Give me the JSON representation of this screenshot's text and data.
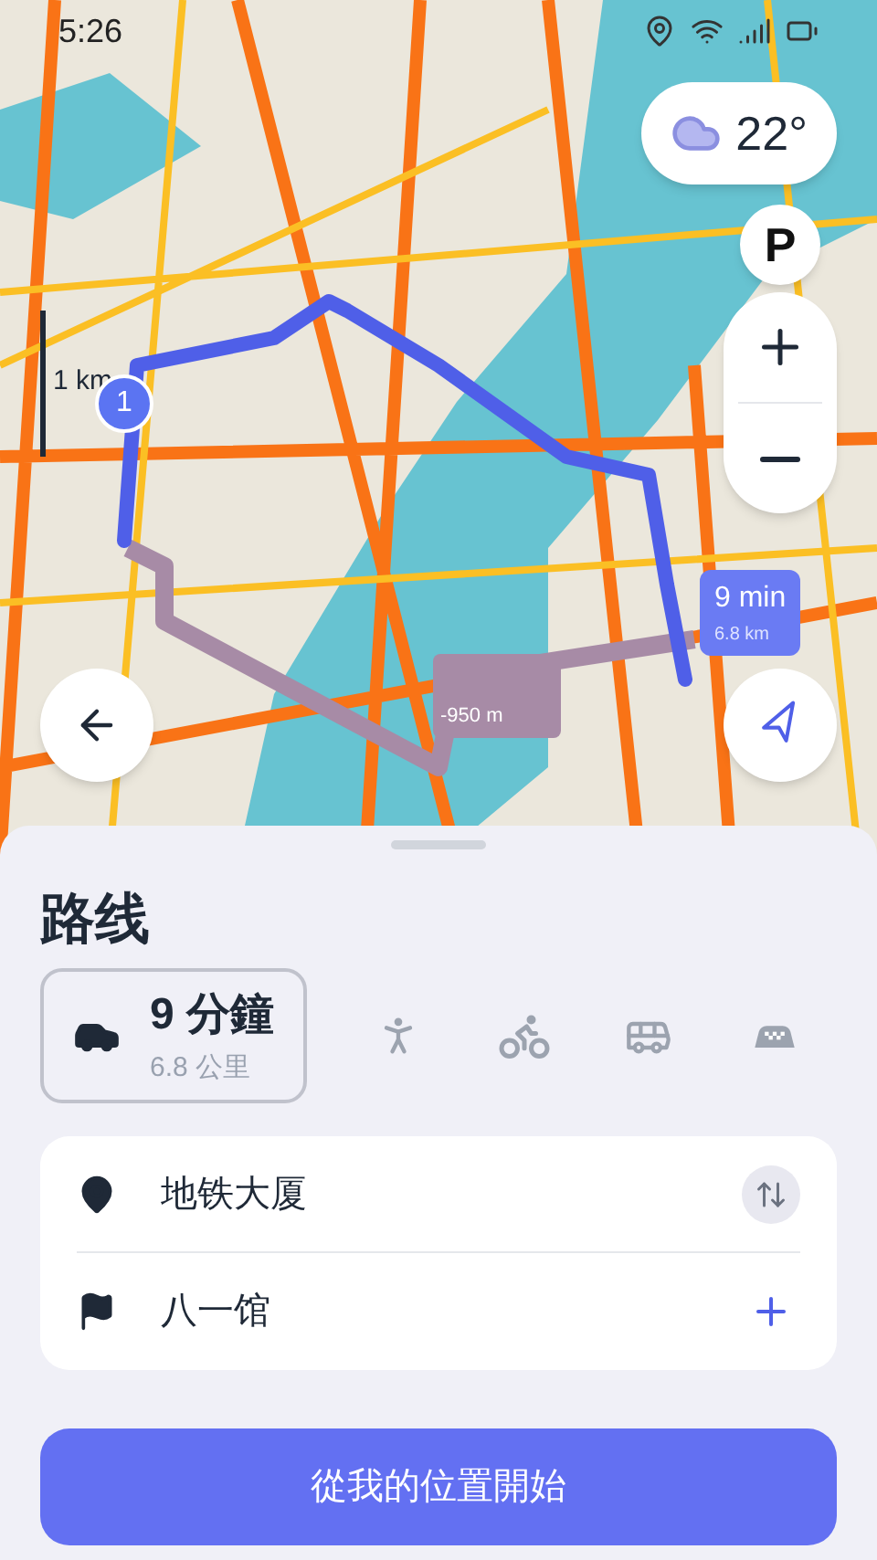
{
  "status_bar": {
    "time": "5:26"
  },
  "map": {
    "weather": {
      "temperature": "22°"
    },
    "scale": "1 km",
    "start_marker": "1",
    "route_label": {
      "time": "9 min",
      "distance": "6.8 km"
    },
    "turn_label": "-950 m",
    "parking": "P"
  },
  "sheet": {
    "title": "路线",
    "modes": [
      {
        "kind": "car",
        "selected": true,
        "time": "9 分鐘",
        "distance": "6.8 公里"
      },
      {
        "kind": "walk",
        "selected": false
      },
      {
        "kind": "bike",
        "selected": false
      },
      {
        "kind": "bus",
        "selected": false
      },
      {
        "kind": "taxi",
        "selected": false
      }
    ],
    "points": [
      {
        "kind": "start",
        "label": "地铁大厦"
      },
      {
        "kind": "finish",
        "label": "八一馆"
      }
    ],
    "start_button": "從我的位置開始"
  }
}
